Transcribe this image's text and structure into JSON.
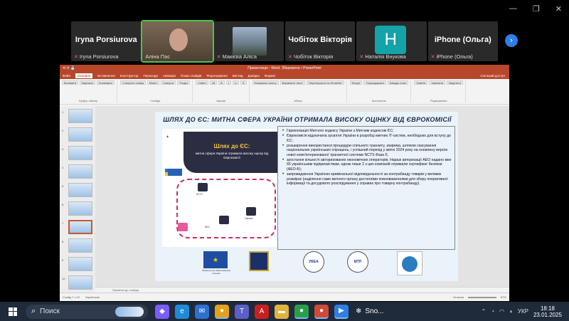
{
  "conference": {
    "participants": [
      {
        "big_name": "Iryna Porsiurova",
        "small_name": "Iryna Porsiurova",
        "type": "name",
        "muted": true
      },
      {
        "big_name": "",
        "small_name": "Аліна Пас",
        "type": "camera",
        "muted": false,
        "active": true
      },
      {
        "big_name": "",
        "small_name": "Макієва Аліса",
        "type": "camera-outdoor",
        "muted": true
      },
      {
        "big_name": "Чобіток Вікторія",
        "small_name": "Чобіток Вікторія",
        "type": "name",
        "muted": true
      },
      {
        "big_name": "",
        "small_name": "Наталія Внукова",
        "type": "avatar",
        "initial": "H",
        "muted": true
      },
      {
        "big_name": "iPhone (Ольга)",
        "small_name": "iPhone (Ольга)",
        "type": "name",
        "muted": true
      }
    ],
    "next_icon": "chevron-right-icon",
    "window_controls": [
      "—",
      "❐",
      "✕"
    ]
  },
  "powerpoint": {
    "title_bar": "Презентація - Word. Збережено • PowerPoint",
    "quick_access": "⟲ ⟳ 💾",
    "tabs": [
      "Файл",
      "Основне",
      "Вставлення",
      "Конструктор",
      "Переходи",
      "Анімація",
      "Показ слайдів",
      "Рецензування",
      "Вигляд",
      "Довідка",
      "Формат"
    ],
    "active_tab": "Основне",
    "share_label": "Спільний доступ",
    "ribbon_groups": [
      {
        "label": "Буфер обміну",
        "buttons": [
          "Вставити",
          "Вирізати",
          "Копіювати"
        ]
      },
      {
        "label": "Слайди",
        "buttons": [
          "Створити слайд",
          "Макет",
          "Скинути",
          "Розділ"
        ]
      },
      {
        "label": "Шрифт",
        "buttons": [
          "Calibri",
          "18",
          "B",
          "I",
          "U",
          "S"
        ]
      },
      {
        "label": "Абзац",
        "buttons": [
          "Напрямок тексту",
          "Вирівняти текст",
          "Перетворити на SmartArt"
        ]
      },
      {
        "label": "Креслення",
        "buttons": [
          "Фігури",
          "Упорядкувати",
          "Швидкі стилі"
        ]
      },
      {
        "label": "Редагування",
        "buttons": [
          "Знайти",
          "Замінити",
          "Виділити"
        ]
      }
    ],
    "thumb_numbers": [
      "1",
      "2",
      "3",
      "4",
      "5",
      "6",
      "7",
      "8",
      "9",
      "10"
    ],
    "notes_placeholder": "Примітки до слайда",
    "status_left": "Слайд 7 з 10",
    "status_lang": "Українська",
    "status_notes": "Нотатки",
    "status_zoom": "67%"
  },
  "slide": {
    "title": "ШЛЯХ ДО ЄС: МИТНА СФЕРА УКРАЇНИ ОТРИМАЛА ВИСОКУ ОЦІНКУ ВІД ЄВРОКОМІСІЇ",
    "infographic": {
      "title": "Шлях до ЄС:",
      "subtitle": "митна сфера України отримала високу оцінку від Єврокомісії",
      "labels": [
        "NCTS",
        "AEO",
        "Транзит"
      ]
    },
    "bullets": [
      "Гармонізація Митного кодексу України з Митним кодексом ЄС;",
      "Єврокомісія відзначила зусилля України в розробці митних IT-систем, необхідних для вступу до ЄС;",
      "розширення використання процедури спільного транзиту, зокрема, шляхом скасування національних українських спрощень, і успішний перехід у квітні 2024 року на оновлену версію нової комп'ютеризованої транзитної системи NCTS Фаза 5;",
      "зростання кількості авторизованих економічних операторів. Наразі авторизації АЕО надано вже 65 українським підприємствам, однак лише 2 з цих компаній отримали сертифікат безпеки (АЕО-Б);",
      "запровадження Україною кримінальної відповідальності за контрабанду товарів у великих розмірах (наділення саме митного органу достатніми повноваженнями для збору оперативної інформації та досудового розслідування у справах про товарну контрабанду)."
    ],
    "logos": {
      "eu_caption": "Фінансується Європейським Союзом",
      "round1": "УБЕА",
      "round2": "МТП"
    }
  },
  "taskbar": {
    "search_placeholder": "Поиск",
    "search_icon": "search-icon",
    "start_icon": "windows-start-icon",
    "apps": [
      {
        "name": "copilot-icon",
        "glyph": "◆",
        "color": "#7a5cff",
        "running": false
      },
      {
        "name": "edge-icon",
        "glyph": "e",
        "color": "#1f8ad9",
        "running": false
      },
      {
        "name": "mail-icon",
        "glyph": "✉",
        "color": "#2f6fd1",
        "running": false
      },
      {
        "name": "chrome-icon",
        "glyph": "●",
        "color": "#e3a21a",
        "running": true
      },
      {
        "name": "teams-icon",
        "glyph": "T",
        "color": "#5b5fc7",
        "running": false
      },
      {
        "name": "acrobat-icon",
        "glyph": "A",
        "color": "#c8201e",
        "running": false
      },
      {
        "name": "files-icon",
        "glyph": "▬",
        "color": "#e2b33c",
        "running": false
      },
      {
        "name": "chrome2-icon",
        "glyph": "●",
        "color": "#2a9d4b",
        "running": true
      },
      {
        "name": "chrome3-icon",
        "glyph": "●",
        "color": "#d04a3a",
        "running": true
      },
      {
        "name": "zoom-icon",
        "glyph": "▶",
        "color": "#2d7fe6",
        "running": true
      }
    ],
    "weather": "Sno...",
    "tray_lang": "УКР",
    "time": "18:18",
    "date": "23.01.2025"
  }
}
